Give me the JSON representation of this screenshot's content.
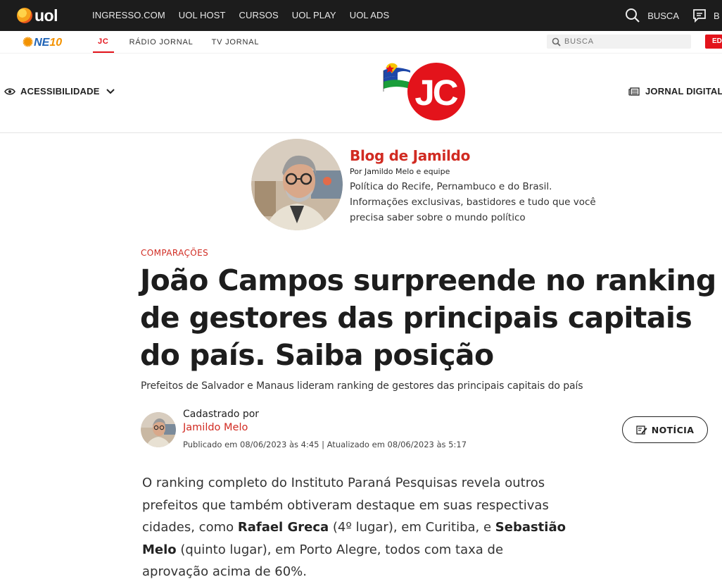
{
  "uol_bar": {
    "logo": "uol",
    "nav": [
      "INGRESSO.COM",
      "UOL HOST",
      "CURSOS",
      "UOL PLAY",
      "UOL ADS"
    ],
    "search_label": "BUSCA",
    "cut_label": "B"
  },
  "ne10_bar": {
    "logo_ne": "NE",
    "logo_ten": "10",
    "nav": [
      "JC",
      "RÁDIO JORNAL",
      "TV JORNAL"
    ],
    "search_placeholder": "BUSCA",
    "cut_button": "ED"
  },
  "header": {
    "accessibility_label": "ACESSIBILIDADE",
    "logo_text": "JC",
    "jornal_label": "JORNAL DIGITAL"
  },
  "blog": {
    "title": "Blog de Jamildo",
    "byline": "Por Jamildo Melo e equipe",
    "description": "Política do Recife, Pernambuco e do Brasil. Informações exclusivas, bastidores e tudo que você precisa saber sobre o mundo político"
  },
  "article": {
    "tag": "COMPARAÇÕES",
    "headline": "João Campos surpreende no ranking de gestores das principais capitais do país. Saiba posição",
    "subtitle": "Prefeitos de Salvador e Manaus lideram ranking de gestores das principais capitais do país",
    "registered_by": "Cadastrado por",
    "author": "Jamildo Melo",
    "dates": "Publicado em 08/06/2023 às 4:45 | Atualizado em 08/06/2023 às 5:17",
    "type_button": "NOTÍCIA",
    "body": {
      "p1": "O ranking completo do Instituto Paraná Pesquisas revela outros prefeitos que também obtiveram destaque em suas respectivas cidades, como ",
      "b1": "Rafael Greca",
      "p2": " (4º lugar), em Curitiba, e ",
      "b2": "Sebastião Melo",
      "p3": " (quinto lugar), em Porto Alegre, todos com taxa de aprovação acima de 60%."
    }
  },
  "colors": {
    "uol_bar": "#1c1c1c",
    "accent_red": "#d12b22",
    "ne10_red": "#e3131b",
    "ne10_blue": "#1f63b6",
    "ne10_orange": "#f39200"
  }
}
